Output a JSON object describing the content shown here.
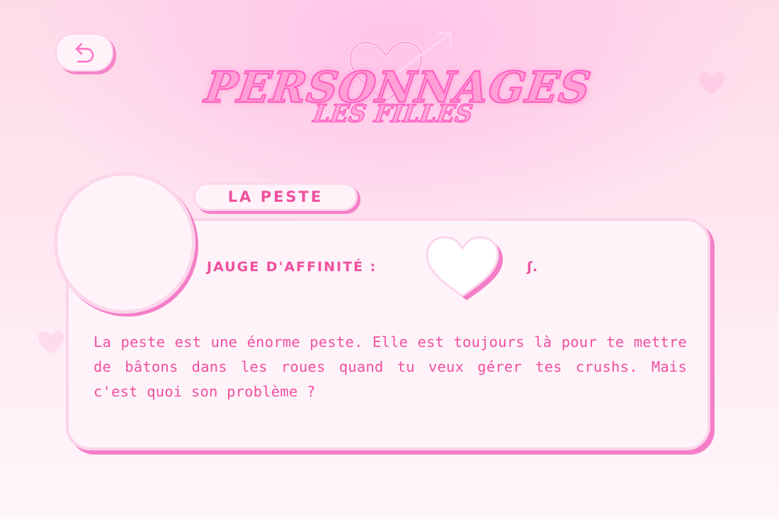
{
  "header": {
    "back_icon": "back-arrow-icon",
    "title": "PERSONNAGES",
    "subtitle": "LES FILLES",
    "title_decoration": "heart-arrow-icon"
  },
  "character": {
    "name": "La peste",
    "gauge_label": "Jauge d'affinité :",
    "gauge_icon": "heart-icon",
    "gauge_suffix": "ʃ.",
    "description": "La peste est une énorme peste. Elle est toujours là pour te mettre de bâtons dans les roues quand tu veux gérer tes crushs. Mais c'est quoi son problème ?"
  },
  "colors": {
    "accent": "#f0509f",
    "shadow": "#f57ec8",
    "card_bg": "#fff3fa",
    "border": "#fbd4ea"
  }
}
